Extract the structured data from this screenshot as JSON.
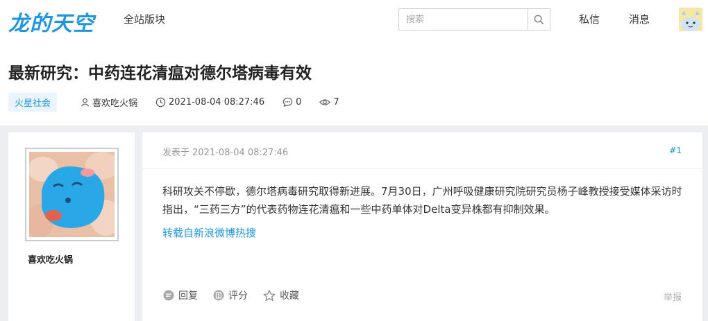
{
  "header": {
    "logo": "龙的天空",
    "nav_all": "全站版块",
    "search_placeholder": "搜索",
    "private_msg": "私信",
    "messages": "消息"
  },
  "thread": {
    "title": "最新研究：中药连花清瘟对德尔塔病毒有效",
    "category": "火星社会",
    "author": "喜欢吃火锅",
    "datetime": "2021-08-04 08:27:46",
    "comments": "0",
    "views": "7"
  },
  "post": {
    "author_name": "喜欢吃火锅",
    "posted_at": "发表于 2021-08-04 08:27:46",
    "floor": "#1",
    "body": "科研攻关不停歇，德尔塔病毒研究取得新进展。7月30日，广州呼吸健康研究院研究员杨子峰教授接受媒体采访时指出，“三药三方”的代表药物连花清瘟和一些中药单体对Delta变异株都有抑制效果。",
    "repost_link": "转载自新浪微博热搜",
    "actions": {
      "reply": "回复",
      "rate": "评分",
      "favorite": "收藏"
    },
    "report": "举报"
  },
  "colors": {
    "accent": "#2196e0",
    "content_bg": "#eceef2"
  },
  "icons": [
    "search-icon",
    "user-icon",
    "clock-icon",
    "comment-icon",
    "eye-icon",
    "reply-icon",
    "rate-icon",
    "star-icon"
  ]
}
